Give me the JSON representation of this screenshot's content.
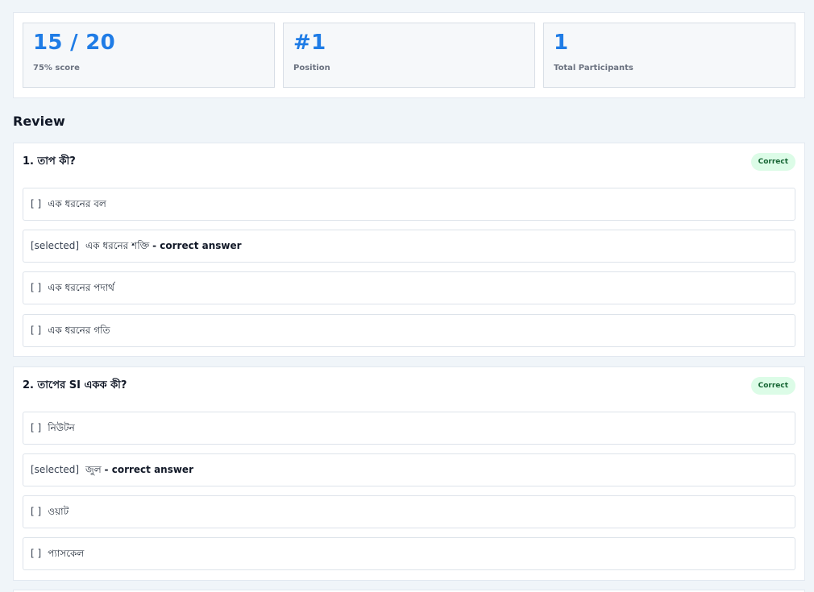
{
  "stats": [
    {
      "value": "15 / 20",
      "label": "75% score"
    },
    {
      "value": "#1",
      "label": "Position"
    },
    {
      "value": "1",
      "label": "Total Participants"
    }
  ],
  "review": {
    "title": "Review",
    "questions": [
      {
        "text": "1. তাপ কী?",
        "status": "Correct",
        "options": [
          {
            "mark": "[ ]",
            "text": "এক ধরনের বল",
            "note": ""
          },
          {
            "mark": "[selected]",
            "text": "এক ধরনের শক্তি",
            "note": "- correct answer"
          },
          {
            "mark": "[ ]",
            "text": "এক ধরনের পদার্থ",
            "note": ""
          },
          {
            "mark": "[ ]",
            "text": "এক ধরনের গতি",
            "note": ""
          }
        ]
      },
      {
        "text": "2. তাপের SI একক কী?",
        "status": "Correct",
        "options": [
          {
            "mark": "[ ]",
            "text": "নিউটন",
            "note": ""
          },
          {
            "mark": "[selected]",
            "text": "জুল",
            "note": "- correct answer"
          },
          {
            "mark": "[ ]",
            "text": "ওয়াট",
            "note": ""
          },
          {
            "mark": "[ ]",
            "text": "প্যাসকেল",
            "note": ""
          }
        ]
      }
    ]
  }
}
